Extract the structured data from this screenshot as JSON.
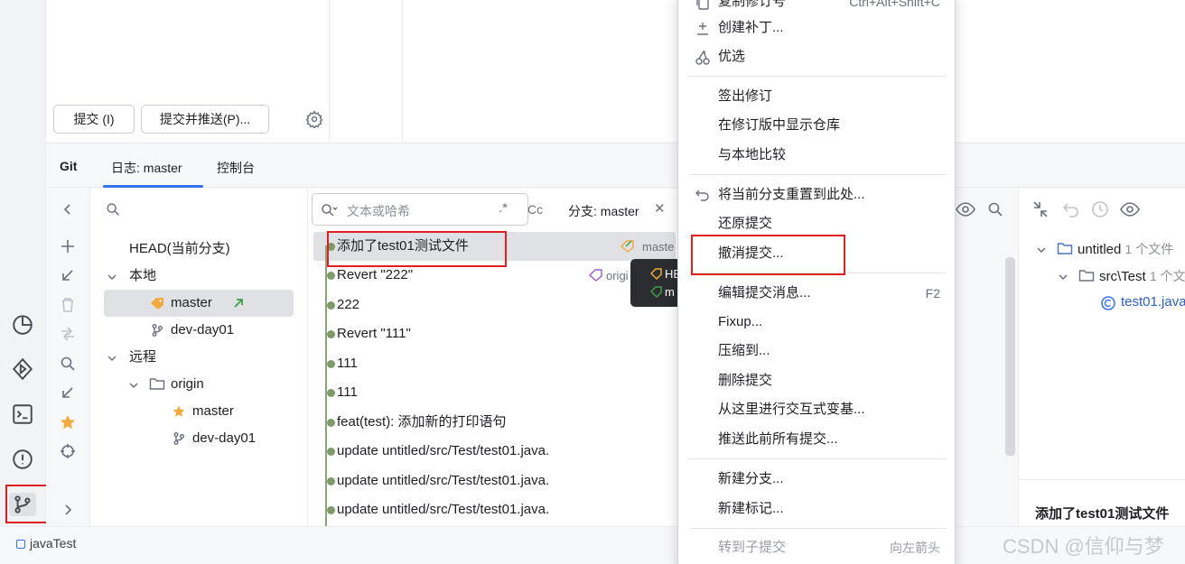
{
  "commit_panel": {
    "commit_button": "提交 (I)",
    "commit_push_button": "提交并推送(P)..."
  },
  "tool_window": {
    "tabs": [
      "Git",
      "日志: master",
      "控制台"
    ]
  },
  "branches": {
    "head": "HEAD(当前分支)",
    "local_label": "本地",
    "local_items": [
      "master",
      "dev-day01"
    ],
    "remote_label": "远程",
    "origin_label": "origin",
    "remote_items": [
      "master",
      "dev-day01"
    ]
  },
  "log": {
    "search_placeholder": "文本或哈希",
    "regex_toggle": ".*",
    "case_toggle": "Cc",
    "branch_filter": "分支: master",
    "commits": [
      "添加了test01测试文件",
      "Revert \"222\"",
      "222",
      "Revert \"111\"",
      "111",
      "111",
      "feat(test): 添加新的打印语句",
      "update untitled/src/Test/test01.java.",
      "update untitled/src/Test/test01.java.",
      "update untitled/src/Test/test01.java."
    ],
    "ref_label_row0": "maste",
    "ref_label_row1": "origi",
    "tooltip_line1": "HE",
    "tooltip_line2": "m"
  },
  "details": {
    "tree": [
      {
        "label": "untitled",
        "meta": "1 个文件"
      },
      {
        "label": "src\\Test",
        "meta": "1 个文"
      },
      {
        "label": "test01.java",
        "meta": ""
      }
    ],
    "commit_message": "添加了test01测试文件"
  },
  "context_menu": {
    "items": [
      {
        "label": "复制修订号",
        "shortcut": "Ctrl+Alt+Shift+C",
        "icon": "copy-icon"
      },
      {
        "label": "创建补丁...",
        "shortcut": "",
        "icon": "patch-icon"
      },
      {
        "label": "优选",
        "shortcut": "",
        "icon": "cherry-pick-icon"
      },
      {
        "label": "签出修订",
        "shortcut": "",
        "icon": ""
      },
      {
        "label": "在修订版中显示仓库",
        "shortcut": "",
        "icon": ""
      },
      {
        "label": "与本地比较",
        "shortcut": "",
        "icon": ""
      },
      {
        "label": "将当前分支重置到此处...",
        "shortcut": "",
        "icon": "reset-icon"
      },
      {
        "label": "还原提交",
        "shortcut": "",
        "icon": ""
      },
      {
        "label": "撤消提交...",
        "shortcut": "",
        "icon": ""
      },
      {
        "label": "编辑提交消息...",
        "shortcut": "F2",
        "icon": ""
      },
      {
        "label": "Fixup...",
        "shortcut": "",
        "icon": ""
      },
      {
        "label": "压缩到...",
        "shortcut": "",
        "icon": ""
      },
      {
        "label": "删除提交",
        "shortcut": "",
        "icon": ""
      },
      {
        "label": "从这里进行交互式变基...",
        "shortcut": "",
        "icon": ""
      },
      {
        "label": "推送此前所有提交...",
        "shortcut": "",
        "icon": ""
      },
      {
        "label": "新建分支...",
        "shortcut": "",
        "icon": ""
      },
      {
        "label": "新建标记...",
        "shortcut": "",
        "icon": ""
      },
      {
        "label": "转到子提交",
        "shortcut": "向左箭头",
        "icon": ""
      }
    ]
  },
  "statusbar": {
    "project": "javaTest"
  },
  "watermark": "CSDN @信仰与梦",
  "colors": {
    "accent": "#3574f0",
    "highlight_box": "#e02020",
    "graph": "#7e9a6a",
    "tag": "#f2a93b"
  }
}
